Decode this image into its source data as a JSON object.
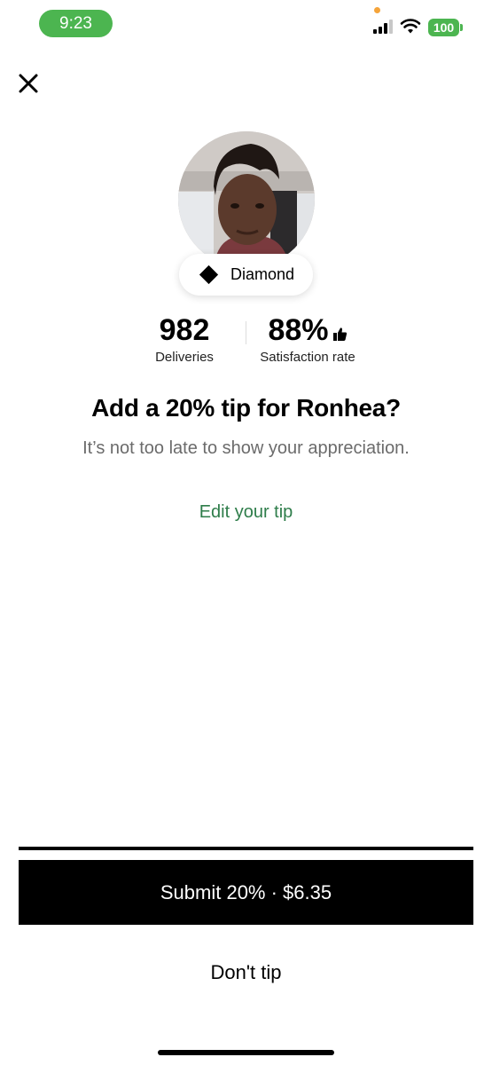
{
  "status_bar": {
    "time": "9:23",
    "battery": "100",
    "accent_color": "#4cb550",
    "icons": [
      "signal-icon",
      "wifi-icon",
      "battery-icon"
    ]
  },
  "header": {
    "close_icon": "close-icon"
  },
  "courier": {
    "tier": "Diamond",
    "tier_icon": "diamond-icon",
    "deliveries_value": "982",
    "deliveries_label": "Deliveries",
    "satisfaction_value": "88%",
    "satisfaction_icon": "thumbs-up-icon",
    "satisfaction_label": "Satisfaction rate"
  },
  "prompt": {
    "headline": "Add a 20% tip for Ronhea?",
    "subline": "It’s not too late to show your appreciation.",
    "edit_link": "Edit your tip",
    "link_color": "#2e7d4a"
  },
  "actions": {
    "submit_label": "Submit 20% · $6.35",
    "dont_tip_label": "Don't tip"
  }
}
